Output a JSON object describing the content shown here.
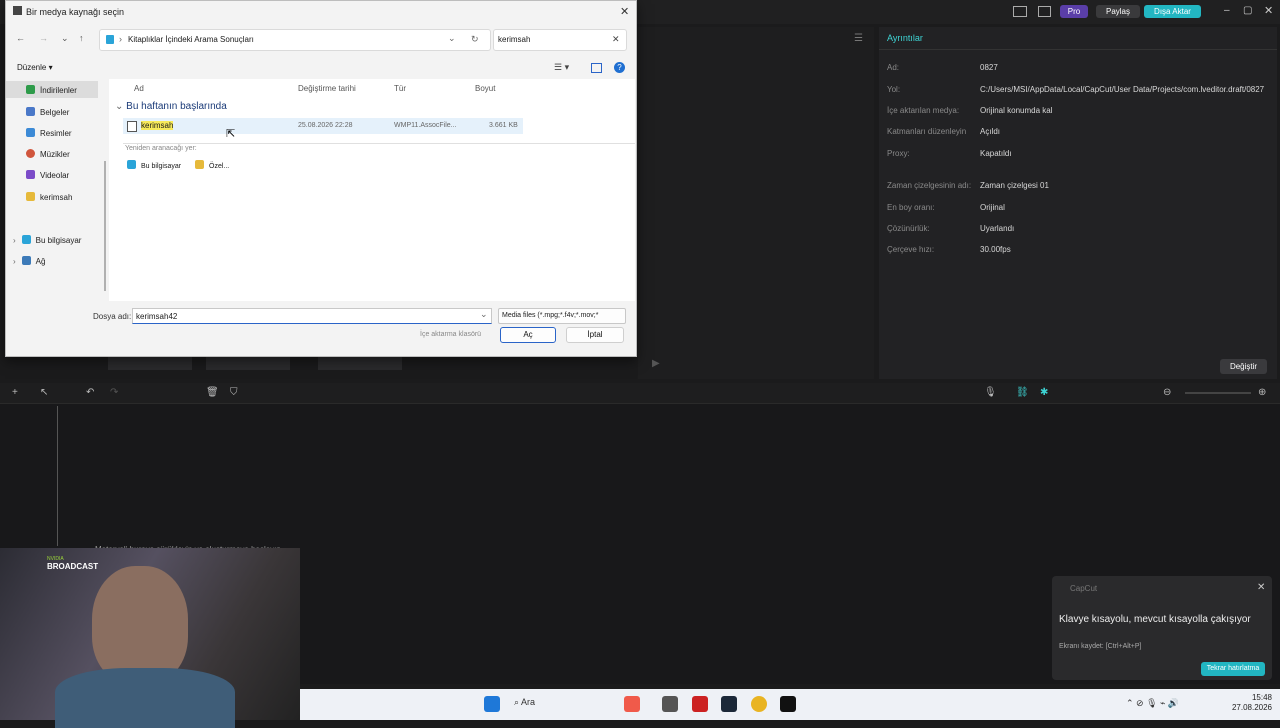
{
  "capcut": {
    "pro_label": "Pro",
    "share_label": "Paylaş",
    "export_label": "Dışa Aktar",
    "details_title": "Ayrıntılar",
    "details": [
      {
        "label": "Ad:",
        "value": "0827"
      },
      {
        "label": "Yol:",
        "value": "C:/Users/MSI/AppData/Local/CapCut/User Data/Projects/com.lveditor.draft/0827"
      },
      {
        "label": "İçe aktarılan medya:",
        "value": "Orijinal konumda kal"
      },
      {
        "label": "Katmanları düzenleyin",
        "value": "Açıldı"
      },
      {
        "label": "Proxy:",
        "value": "Kapatıldı"
      },
      {
        "label": "Zaman çizelgesinin adı:",
        "value": "Zaman çizelgesi 01"
      },
      {
        "label": "En boy oranı:",
        "value": "Orijinal"
      },
      {
        "label": "Çözünürlük:",
        "value": "Uyarlandı"
      },
      {
        "label": "Çerçeve hızı:",
        "value": "30.00fps"
      }
    ],
    "change_button": "Değiştir",
    "timeline_hint": "Materyali buraya sürükleyin ve oluşturmaya başlayın"
  },
  "dialog": {
    "title": "Bir medya kaynağı seçin",
    "address": "Kitaplıklar İçindeki Arama Sonuçları",
    "search_value": "kerimsah",
    "organize_label": "Düzenle",
    "nav_items": [
      {
        "label": "İndirilenler",
        "icon": "download-icon",
        "color": "#2e9b4a"
      },
      {
        "label": "Belgeler",
        "icon": "documents-icon",
        "color": "#4a78c8"
      },
      {
        "label": "Resimler",
        "icon": "pictures-icon",
        "color": "#3c8ad6"
      },
      {
        "label": "Müzikler",
        "icon": "music-icon",
        "color": "#d0553c"
      },
      {
        "label": "Videolar",
        "icon": "videos-icon",
        "color": "#7b4bc8"
      },
      {
        "label": "kerimsah",
        "icon": "folder-icon",
        "color": "#e6b93a"
      }
    ],
    "tree_items": [
      {
        "label": "Bu bilgisayar",
        "icon": "this-pc-icon"
      },
      {
        "label": "Ağ",
        "icon": "network-icon"
      }
    ],
    "columns": {
      "name": "Ad",
      "date": "Değiştirme tarihi",
      "type": "Tür",
      "size": "Boyut"
    },
    "group_title": "Bu haftanın başlarında",
    "file": {
      "name": "kerimsah",
      "date": "25.08.2026 22:28",
      "type": "WMP11.AssocFile...",
      "size": "3.661 KB"
    },
    "search_again_label": "Yeniden aranacağı yer:",
    "search_again_items": [
      "Bu bilgisayar",
      "Özel..."
    ],
    "filename_label": "Dosya adı:",
    "filename_value": "kerimsah42",
    "filter_value": "Media files (*.mpg;*.f4v;*.mov;*",
    "import_folder": "İçe aktarma klasörü",
    "open_button": "Aç",
    "cancel_button": "İptal"
  },
  "toast": {
    "app": "CapCut",
    "title": "Klavye kısayolu, mevcut kısayolla çakışıyor",
    "body": "Ekranı kaydet: [Ctrl+Alt+P]",
    "button": "Tekrar hatırlatma"
  },
  "webcam": {
    "brand_top": "NVIDIA",
    "brand": "BROADCAST"
  },
  "taskbar": {
    "search": "Ara",
    "time": "15:48",
    "date": "27.08.2026"
  }
}
